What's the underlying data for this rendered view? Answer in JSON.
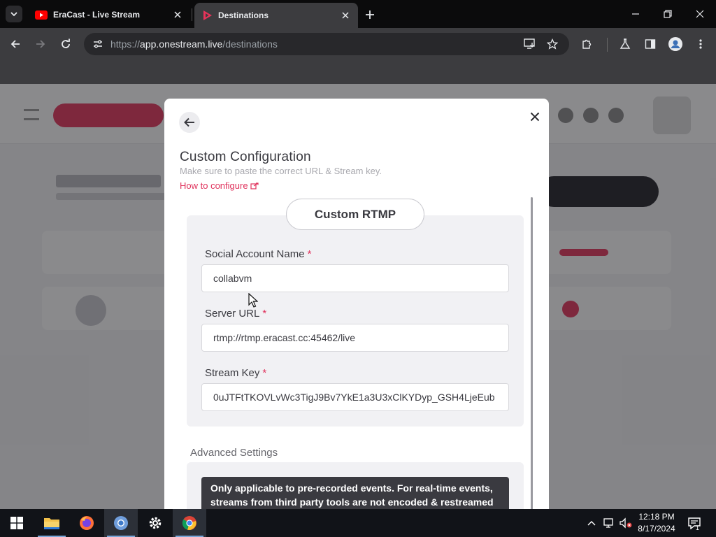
{
  "browser": {
    "tabs": [
      {
        "label": "EraCast - Live Stream",
        "active": false,
        "favicon": "youtube-icon"
      },
      {
        "label": "Destinations",
        "active": true,
        "favicon": "onestream-icon"
      }
    ],
    "url_prefix": "https://",
    "url_host": "app.onestream.live",
    "url_path": "/destinations"
  },
  "modal": {
    "title": "Custom Configuration",
    "subtitle": "Make sure to paste the correct URL & Stream key.",
    "how_to_link": "How to configure",
    "type_label": "Custom RTMP",
    "fields": [
      {
        "label": "Social Account Name",
        "required": "*",
        "value": "collabvm"
      },
      {
        "label": "Server URL",
        "required": "*",
        "value": "rtmp://rtmp.eracast.cc:45462/live"
      },
      {
        "label": "Stream Key",
        "required": "*",
        "value": "0uJTFtTKOVLvWc3TigJ9Bv7YkE1a3U3xClKYDyp_GSH4LjeEub"
      }
    ],
    "advanced_title": "Advanced Settings",
    "advanced_note": "Only applicable to pre-recorded events. For real-time events, streams from third party tools are not encoded & restreamed as"
  },
  "taskbar": {
    "time": "12:18 PM",
    "date": "8/17/2024",
    "notification_count": "1",
    "apps": [
      "windows-start",
      "file-explorer",
      "firefox",
      "chromium",
      "settings",
      "chrome"
    ]
  },
  "colors": {
    "accent": "#e0325c",
    "modal_text": "#3a3a40",
    "chrome_dark": "#3c3c3f"
  }
}
